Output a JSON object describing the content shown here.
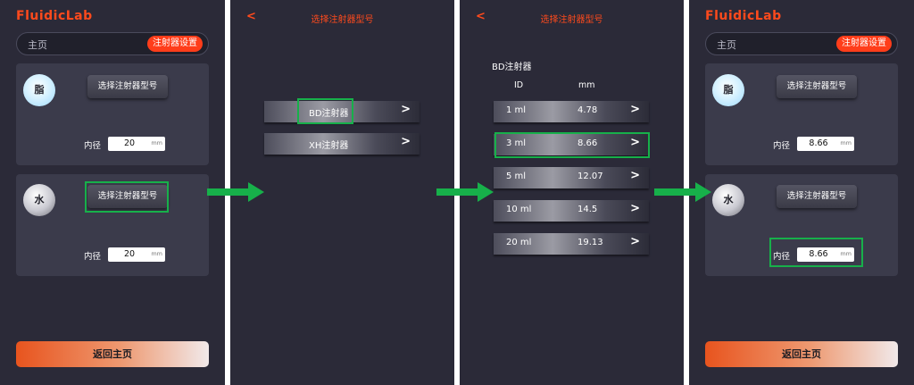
{
  "brand": {
    "logo": "FluidicLab"
  },
  "tabs": {
    "home": "主页",
    "active": "注射器设置"
  },
  "settings_before": {
    "fat": {
      "icon_text": "脂",
      "select_label": "选择注射器型号",
      "diameter_label": "内径",
      "diameter_value": "20",
      "unit": "mm"
    },
    "water": {
      "icon_text": "水",
      "select_label": "选择注射器型号",
      "diameter_label": "内径",
      "diameter_value": "20",
      "unit": "mm"
    },
    "home_button": "返回主页"
  },
  "brand_select": {
    "back": "<",
    "title": "选择注射器型号",
    "items": [
      {
        "label": "BD注射器",
        "chevron": ">"
      },
      {
        "label": "XH注射器",
        "chevron": ">"
      }
    ]
  },
  "bd_select": {
    "back": "<",
    "title": "选择注射器型号",
    "heading": "BD注射器",
    "col_id": "ID",
    "col_mm": "mm",
    "rows": [
      {
        "id": "1 ml",
        "mm": "4.78",
        "chevron": ">"
      },
      {
        "id": "3 ml",
        "mm": "8.66",
        "chevron": ">"
      },
      {
        "id": "5 ml",
        "mm": "12.07",
        "chevron": ">"
      },
      {
        "id": "10 ml",
        "mm": "14.5",
        "chevron": ">"
      },
      {
        "id": "20 ml",
        "mm": "19.13",
        "chevron": ">"
      }
    ]
  },
  "settings_after": {
    "fat": {
      "icon_text": "脂",
      "select_label": "选择注射器型号",
      "diameter_label": "内径",
      "diameter_value": "8.66",
      "unit": "mm"
    },
    "water": {
      "icon_text": "水",
      "select_label": "选择注射器型号",
      "diameter_label": "内径",
      "diameter_value": "8.66",
      "unit": "mm"
    },
    "home_button": "返回主页"
  },
  "colors": {
    "accent": "#ff3d1a",
    "highlight": "#17b04a",
    "panel_bg": "#2b2a38",
    "card_bg": "#3b3b4b"
  }
}
